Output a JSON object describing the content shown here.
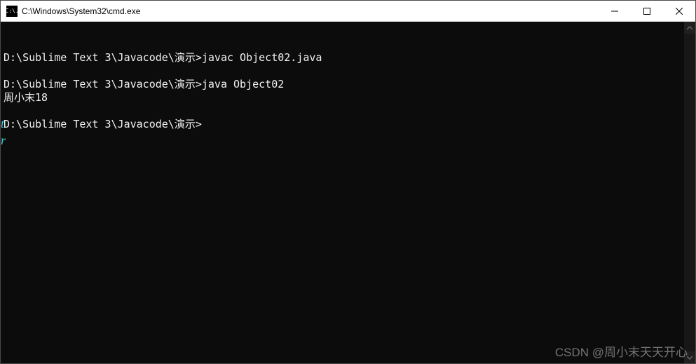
{
  "window": {
    "title": "C:\\Windows\\System32\\cmd.exe",
    "icon_label": "C:\\."
  },
  "console": {
    "lines": [
      "",
      "D:\\Sublime Text 3\\Javacode\\演示>javac Object02.java",
      "",
      "D:\\Sublime Text 3\\Javacode\\演示>java Object02",
      "周小末18",
      "",
      "D:\\Sublime Text 3\\Javacode\\演示>"
    ]
  },
  "side_chars": {
    "t": "t",
    "r": "r"
  },
  "watermark": "CSDN @周小末天天开心"
}
